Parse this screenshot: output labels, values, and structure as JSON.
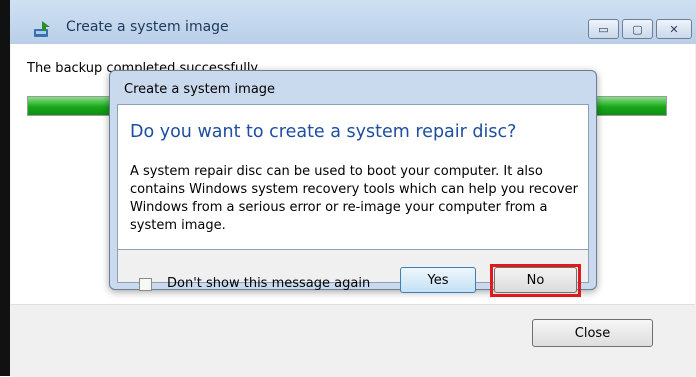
{
  "window": {
    "title": "Create a system image",
    "controls": {
      "minimize": "▭",
      "maximize": "▢",
      "close": "✕"
    }
  },
  "main": {
    "status_text": "The backup completed successfully.",
    "progress_fraction": 1.0,
    "close_label": "Close"
  },
  "dialog": {
    "title": "Create a system image",
    "heading": "Do you want to create a system repair disc?",
    "body": "A system repair disc can be used to boot your computer. It also contains Windows system recovery tools which can help you recover Windows from a serious error or re-image your computer from a system image.",
    "checkbox_label": "Don't show this message again",
    "yes_label": "Yes",
    "no_label": "No"
  },
  "colors": {
    "heading": "#1e4ea0",
    "highlight": "#e0191c",
    "progress": "#18a81a"
  }
}
